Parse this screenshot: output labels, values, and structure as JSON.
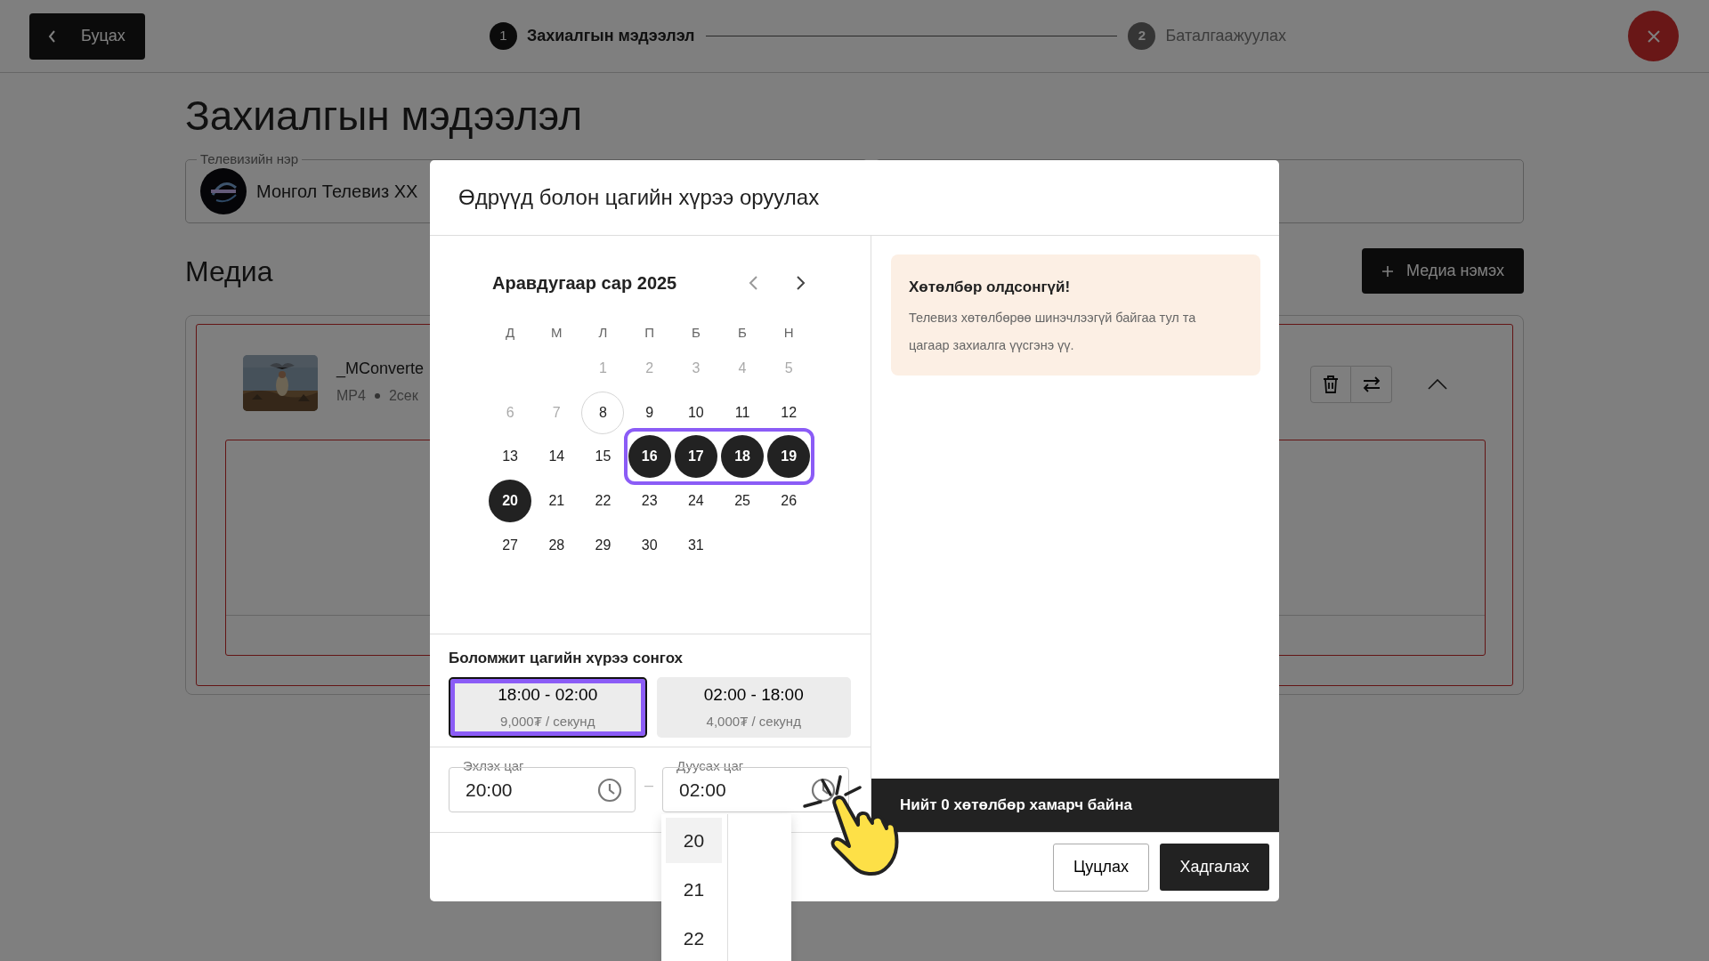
{
  "top_bar": {
    "back_button": "Буцах",
    "steps": [
      {
        "number": "1",
        "label": "Захиалгын мэдээлэл",
        "active": true
      },
      {
        "number": "2",
        "label": "Баталгаажуулах",
        "active": false
      }
    ]
  },
  "page": {
    "title": "Захиалгын мэдээлэл",
    "tv_field": {
      "label": "Телевизийн нэр",
      "value": "Монгол Телевиз ХХ"
    },
    "media_heading": "Медиа",
    "add_media_button": "Медиа нэмэх",
    "media_item": {
      "filename": "_MConverte",
      "format": "MP4",
      "duration": "2сек"
    }
  },
  "modal": {
    "title": "Өдрүүд болон цагийн хүрээ оруулах",
    "calendar": {
      "month": "Аравдугаар сар 2025",
      "range_outlined": true,
      "weekdays": [
        "Д",
        "М",
        "Л",
        "П",
        "Б",
        "Б",
        "Н"
      ],
      "weeks": [
        {
          "days": [
            {
              "label": "1",
              "muted": true,
              "today": false,
              "selected": false
            },
            {
              "label": "2",
              "muted": true,
              "today": false,
              "selected": false
            },
            {
              "label": "3",
              "muted": true,
              "today": false,
              "selected": false
            },
            {
              "label": "4",
              "muted": true,
              "today": false,
              "selected": false
            },
            {
              "label": "5",
              "muted": true,
              "today": false,
              "selected": false
            }
          ]
        },
        {
          "days": [
            {
              "label": "6",
              "muted": true,
              "today": false,
              "selected": false
            },
            {
              "label": "7",
              "muted": true,
              "today": false,
              "selected": false
            },
            {
              "label": "8",
              "muted": false,
              "today": true,
              "selected": false
            },
            {
              "label": "9",
              "muted": false,
              "today": false,
              "selected": false
            },
            {
              "label": "10",
              "muted": false,
              "today": false,
              "selected": false
            },
            {
              "label": "11",
              "muted": false,
              "today": false,
              "selected": false
            },
            {
              "label": "12",
              "muted": false,
              "today": false,
              "selected": false
            }
          ]
        },
        {
          "days": [
            {
              "label": "13",
              "muted": false,
              "today": false,
              "selected": false
            },
            {
              "label": "14",
              "muted": false,
              "today": false,
              "selected": false
            },
            {
              "label": "15",
              "muted": false,
              "today": false,
              "selected": false
            },
            {
              "label": "16",
              "muted": false,
              "today": false,
              "selected": true
            },
            {
              "label": "17",
              "muted": false,
              "today": false,
              "selected": true
            },
            {
              "label": "18",
              "muted": false,
              "today": false,
              "selected": true
            },
            {
              "label": "19",
              "muted": false,
              "today": false,
              "selected": true
            }
          ]
        },
        {
          "days": [
            {
              "label": "20",
              "muted": false,
              "today": false,
              "selected": true
            },
            {
              "label": "21",
              "muted": false,
              "today": false,
              "selected": false
            },
            {
              "label": "22",
              "muted": false,
              "today": false,
              "selected": false
            },
            {
              "label": "23",
              "muted": false,
              "today": false,
              "selected": false
            },
            {
              "label": "24",
              "muted": false,
              "today": false,
              "selected": false
            },
            {
              "label": "25",
              "muted": false,
              "today": false,
              "selected": false
            },
            {
              "label": "26",
              "muted": false,
              "today": false,
              "selected": false
            }
          ]
        },
        {
          "days": [
            {
              "label": "27",
              "muted": false,
              "today": false,
              "selected": false
            },
            {
              "label": "28",
              "muted": false,
              "today": false,
              "selected": false
            },
            {
              "label": "29",
              "muted": false,
              "today": false,
              "selected": false
            },
            {
              "label": "30",
              "muted": false,
              "today": false,
              "selected": false
            },
            {
              "label": "31",
              "muted": false,
              "today": false,
              "selected": false
            }
          ]
        }
      ]
    },
    "slots_label": "Боломжит цагийн хүрээ сонгох",
    "time_slots": [
      {
        "time": "18:00 - 02:00",
        "price": "9,000₮ / секунд",
        "selected": true
      },
      {
        "time": "02:00 - 18:00",
        "price": "4,000₮ / секунд",
        "selected": false
      }
    ],
    "time_fields": [
      {
        "label": "Эхлэх цаг",
        "value": "20:00"
      },
      {
        "label": "Дуусах цаг",
        "value": "02:00"
      }
    ],
    "separator": "–",
    "hour_options": [
      {
        "label": "20",
        "selected": true
      },
      {
        "label": "21",
        "selected": false
      },
      {
        "label": "22",
        "selected": false
      }
    ],
    "alert": {
      "title": "Хөтөлбөр олдсонгүй!",
      "message": "Телевиз хөтөлбөрөө шинэчлээгүй байгаа тул та цагаар захиалга үүсгэнэ үү."
    },
    "summary": "Нийт 0 хөтөлбөр хамарч байна",
    "cancel_button": "Цуцлах",
    "save_button": "Хадгалах"
  }
}
